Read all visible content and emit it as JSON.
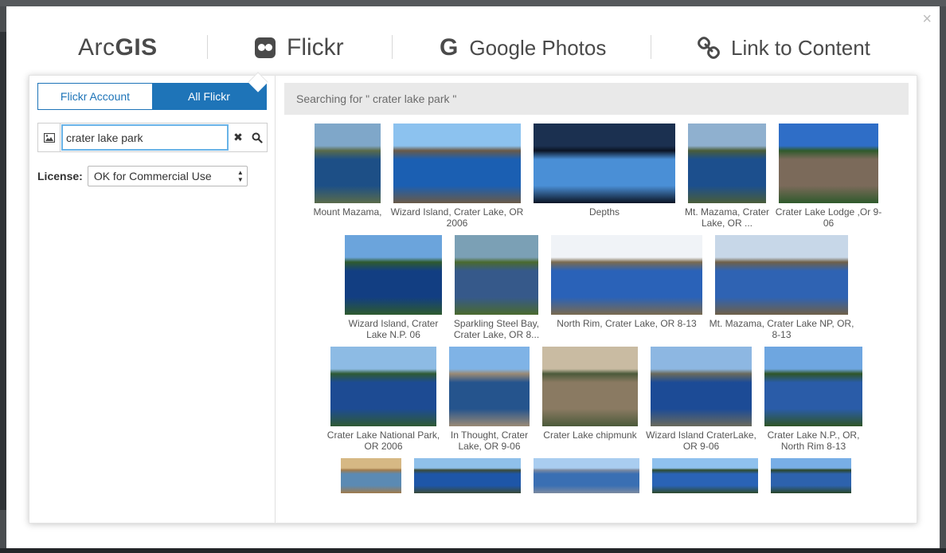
{
  "modal": {
    "close_label": "×"
  },
  "tabs": {
    "arcgis_prefix": "Arc",
    "arcgis_suffix": "GIS",
    "flickr": "Flickr",
    "google": "Google Photos",
    "link": "Link to Content"
  },
  "left": {
    "seg_account": "Flickr Account",
    "seg_all": "All Flickr",
    "search_value": "crater lake park",
    "license_label": "License:",
    "license_value": "OK for Commercial Use"
  },
  "right": {
    "searching_text": "Searching for \" crater lake park \""
  },
  "results": [
    {
      "caption": "Mount Mazama,",
      "colors": [
        "#7fa7c9",
        "#1d4f86",
        "#5a6b4a"
      ]
    },
    {
      "caption": "Wizard Island, Crater Lake, OR 2006",
      "colors": [
        "#8cc2ef",
        "#1b5fb2",
        "#6a5a47"
      ]
    },
    {
      "caption": "Depths",
      "colors": [
        "#1b3050",
        "#4a8fd6",
        "#0b1424"
      ]
    },
    {
      "caption": "Mt. Mazama, Crater Lake, OR ...",
      "colors": [
        "#8fb0cf",
        "#1c4f8d",
        "#4a5d39"
      ]
    },
    {
      "caption": "Crater Lake Lodge ,Or 9-06",
      "colors": [
        "#2f6ec7",
        "#7b6a5a",
        "#2f5a2c"
      ]
    },
    {
      "caption": "Wizard Island, Crater Lake N.P. 06",
      "colors": [
        "#6ba4dc",
        "#123e82",
        "#2e5a2e"
      ]
    },
    {
      "caption": "Sparkling Steel Bay, Crater Lake, OR 8...",
      "colors": [
        "#7ba0b5",
        "#36598a",
        "#4a6a2e"
      ]
    },
    {
      "caption": "North Rim, Crater Lake, OR 8-13",
      "colors": [
        "#f0f3f7",
        "#2a62b8",
        "#7a6a4f"
      ]
    },
    {
      "caption": "Mt. Mazama, Crater Lake NP, OR, 8-13",
      "colors": [
        "#c7d7e8",
        "#2f63b3",
        "#6f6048"
      ]
    },
    {
      "caption": "Crater Lake National Park, OR 2006",
      "colors": [
        "#8dbbe4",
        "#1d4b93",
        "#2f5a34"
      ]
    },
    {
      "caption": "In Thought, Crater Lake, OR 9-06",
      "colors": [
        "#7fb3e6",
        "#25548d",
        "#9a8a75"
      ]
    },
    {
      "caption": "Crater Lake chipmunk",
      "colors": [
        "#c9bba2",
        "#8a7a62",
        "#4b5a3a"
      ]
    },
    {
      "caption": "Wizard Island CraterLake, OR 9-06",
      "colors": [
        "#8db7e2",
        "#1c4b96",
        "#6a6a5c"
      ]
    },
    {
      "caption": "Crater Lake N.P., OR, North Rim 8-13",
      "colors": [
        "#6ea6e0",
        "#2a5ca8",
        "#2f5526"
      ]
    },
    {
      "caption": "",
      "colors": [
        "#d6b884",
        "#5b8ab3",
        "#a07a4a"
      ]
    },
    {
      "caption": "",
      "colors": [
        "#8fc0ea",
        "#1e56a8",
        "#3b4a36"
      ]
    },
    {
      "caption": "",
      "colors": [
        "#a9cdf0",
        "#3a6fb3",
        "#7c8aa0"
      ]
    },
    {
      "caption": "",
      "colors": [
        "#8fc1ee",
        "#2a63b6",
        "#2e4a2a"
      ]
    },
    {
      "caption": "",
      "colors": [
        "#78aee6",
        "#2d62ad",
        "#2a4526"
      ]
    }
  ]
}
